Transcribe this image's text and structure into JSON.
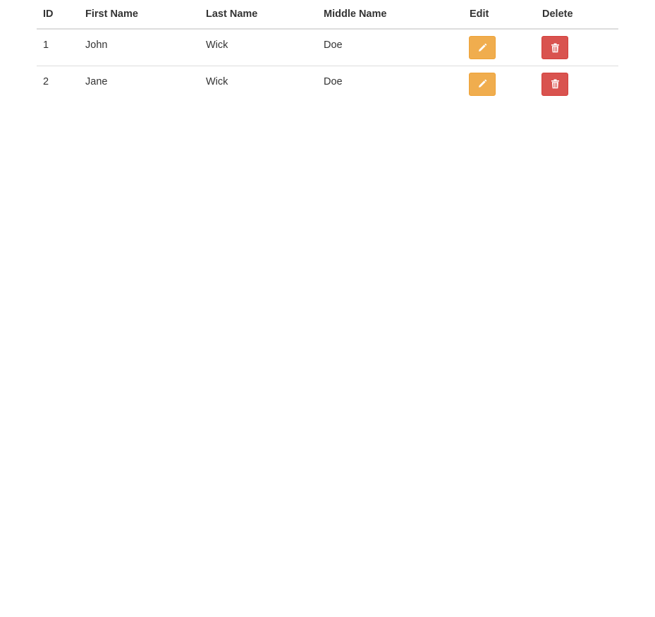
{
  "table": {
    "headers": {
      "id": "ID",
      "first_name": "First Name",
      "last_name": "Last Name",
      "middle_name": "Middle Name",
      "edit": "Edit",
      "delete": "Delete"
    },
    "rows": [
      {
        "id": "1",
        "first_name": "John",
        "last_name": "Wick",
        "middle_name": "Doe"
      },
      {
        "id": "2",
        "first_name": "Jane",
        "last_name": "Wick",
        "middle_name": "Doe"
      }
    ]
  },
  "icons": {
    "edit": "pencil-icon",
    "delete": "trash-icon"
  },
  "colors": {
    "edit_button": "#f0ad4e",
    "delete_button": "#d9534f",
    "text": "#333333",
    "border": "#dddddd"
  }
}
